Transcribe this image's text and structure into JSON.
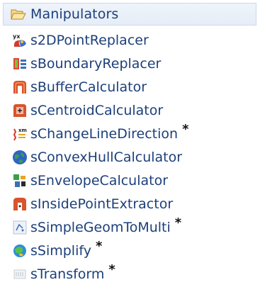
{
  "panel": {
    "title": "Manipulators",
    "title_icon": "folder-open-icon"
  },
  "items": [
    {
      "label": "s2DPointReplacer",
      "icon": "point-replacer-icon",
      "star": ""
    },
    {
      "label": "sBoundaryReplacer",
      "icon": "boundary-replacer-icon",
      "star": ""
    },
    {
      "label": "sBufferCalculator",
      "icon": "buffer-calculator-icon",
      "star": ""
    },
    {
      "label": "sCentroidCalculator",
      "icon": "centroid-calculator-icon",
      "star": ""
    },
    {
      "label": "sChangeLineDirection",
      "icon": "change-line-direction-icon",
      "star": "*"
    },
    {
      "label": "sConvexHullCalculator",
      "icon": "convex-hull-icon",
      "star": ""
    },
    {
      "label": "sEnvelopeCalculator",
      "icon": "envelope-calculator-icon",
      "star": ""
    },
    {
      "label": "sInsidePointExtractor",
      "icon": "inside-point-extractor-icon",
      "star": ""
    },
    {
      "label": "sSimpleGeomToMulti",
      "icon": "simple-geom-to-multi-icon",
      "star": "*"
    },
    {
      "label": "sSimplify",
      "icon": "simplify-icon",
      "star": "*"
    },
    {
      "label": "sTransform",
      "icon": "transform-icon",
      "star": "*"
    }
  ]
}
